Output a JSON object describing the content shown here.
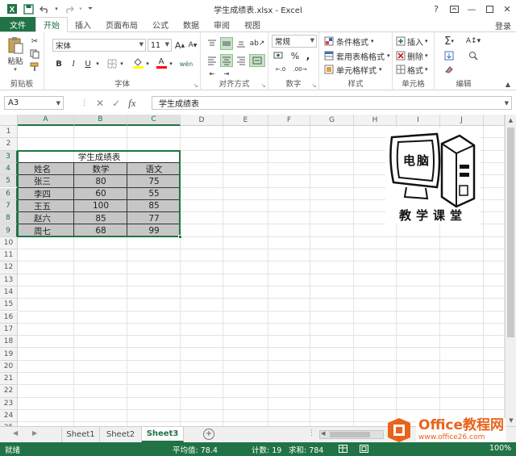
{
  "window": {
    "title": "学生成绩表.xlsx - Excel",
    "help": "?",
    "login": "登录"
  },
  "tabs": [
    "文件",
    "开始",
    "插入",
    "页面布局",
    "公式",
    "数据",
    "审阅",
    "视图"
  ],
  "ribbon": {
    "clipboard": {
      "paste": "粘贴",
      "label": "剪贴板"
    },
    "font": {
      "name": "宋体",
      "size": "11",
      "bold": "B",
      "italic": "I",
      "underline": "U",
      "grow": "A",
      "shrink": "A",
      "fill_color": "A",
      "font_color": "A",
      "wen": "wén",
      "label": "字体"
    },
    "alignment": {
      "label": "对齐方式"
    },
    "number": {
      "format": "常规",
      "percent": "%",
      "comma": ",",
      "label": "数字"
    },
    "styles": {
      "conditional": "条件格式",
      "table": "套用表格格式",
      "cell": "单元格样式",
      "label": "样式"
    },
    "cells": {
      "insert": "插入",
      "delete": "删除",
      "format": "格式",
      "label": "单元格"
    },
    "editing": {
      "sum": "Σ",
      "label": "编辑"
    }
  },
  "formula_bar": {
    "name_box": "A3",
    "fx": "fx",
    "content": "学生成绩表"
  },
  "columns": [
    "A",
    "B",
    "C",
    "D",
    "E",
    "F",
    "G",
    "H",
    "I",
    "J"
  ],
  "rows": [
    "1",
    "2",
    "3",
    "4",
    "5",
    "6",
    "7",
    "8",
    "9",
    "10",
    "11",
    "12",
    "13",
    "14",
    "15",
    "16",
    "17",
    "18",
    "19",
    "20",
    "21",
    "22",
    "23",
    "24",
    "25"
  ],
  "table": {
    "title": "学生成绩表",
    "headers": [
      "姓名",
      "数学",
      "语文"
    ],
    "data": [
      [
        "张三",
        "80",
        "75"
      ],
      [
        "李四",
        "60",
        "55"
      ],
      [
        "王五",
        "100",
        "85"
      ],
      [
        "赵六",
        "85",
        "77"
      ],
      [
        "周七",
        "68",
        "99"
      ]
    ]
  },
  "picture": {
    "monitor_text": "电脑",
    "caption": "教学课堂"
  },
  "sheets": [
    "Sheet1",
    "Sheet2",
    "Sheet3"
  ],
  "active_sheet": "Sheet3",
  "status": {
    "ready": "就绪",
    "average": "平均值: 78.4",
    "count": "计数: 19",
    "sum": "求和: 784",
    "zoom": "100%"
  },
  "watermark": {
    "brand": "Office教程网",
    "url": "www.office26.com"
  },
  "colors": {
    "accent": "#217346",
    "selection_fill": "#c6c6c6"
  }
}
